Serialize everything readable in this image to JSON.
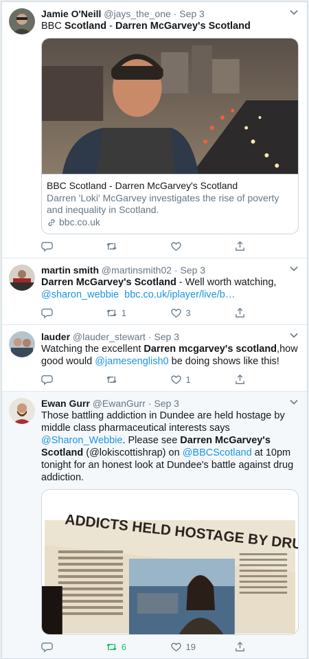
{
  "tweets": [
    {
      "name": "Jamie O'Neill",
      "handle": "@jays_the_one",
      "dot": "·",
      "time": "Sep 3",
      "text_plain1": "BBC ",
      "text_bold1": "Scotland",
      "text_plain2": " - ",
      "text_bold2": "Darren McGarvey's Scotland",
      "card": {
        "title": "BBC Scotland - Darren McGarvey's Scotland",
        "description": "Darren 'Loki' McGarvey investigates the rise of poverty and inequality in Scotland.",
        "url": "bbc.co.uk"
      },
      "retweets": "",
      "likes": ""
    },
    {
      "name": "martin smith",
      "handle": "@martinsmith02",
      "dot": "·",
      "time": "Sep 3",
      "text_bold1": "Darren McGarvey's Scotland",
      "text_plain1": " - Well worth watching,",
      "mention": "@sharon_webbie",
      "link": "bbc.co.uk/iplayer/live/b…",
      "retweets": "1",
      "likes": "3"
    },
    {
      "name": "lauder",
      "handle": "@lauder_stewart",
      "dot": "·",
      "time": "Sep 3",
      "text_plain1": "Watching the excellent ",
      "text_bold1": "Darren mcgarvey's scotland",
      "text_plain2": ",how good would ",
      "mention": "@jamesenglish0",
      "text_plain3": " be doing shows like this!",
      "retweets": "",
      "likes": "1"
    },
    {
      "name": "Ewan Gurr",
      "handle": "@EwanGurr",
      "dot": "·",
      "time": "Sep 3",
      "text_plain1": "Those battling addiction in Dundee are held hostage by middle class pharmaceutical interests says ",
      "mention1": "@Sharon_Webbie",
      "text_plain2": ". Please see ",
      "text_bold1": "Darren McGarvey's Scotland",
      "text_plain3": " (@lokiscottishrap) on ",
      "mention2": "@BBCScotland",
      "text_plain4": " at 10pm tonight for an honest look at Dundee's battle against drug addiction.",
      "photo_headline": "ADDICTS HELD HOSTAGE BY DRUG INTERESTS",
      "retweets": "6",
      "likes": "19"
    }
  ],
  "colors": {
    "link": "#1b95e0",
    "muted": "#657786",
    "retweet_active": "#17bf63"
  }
}
